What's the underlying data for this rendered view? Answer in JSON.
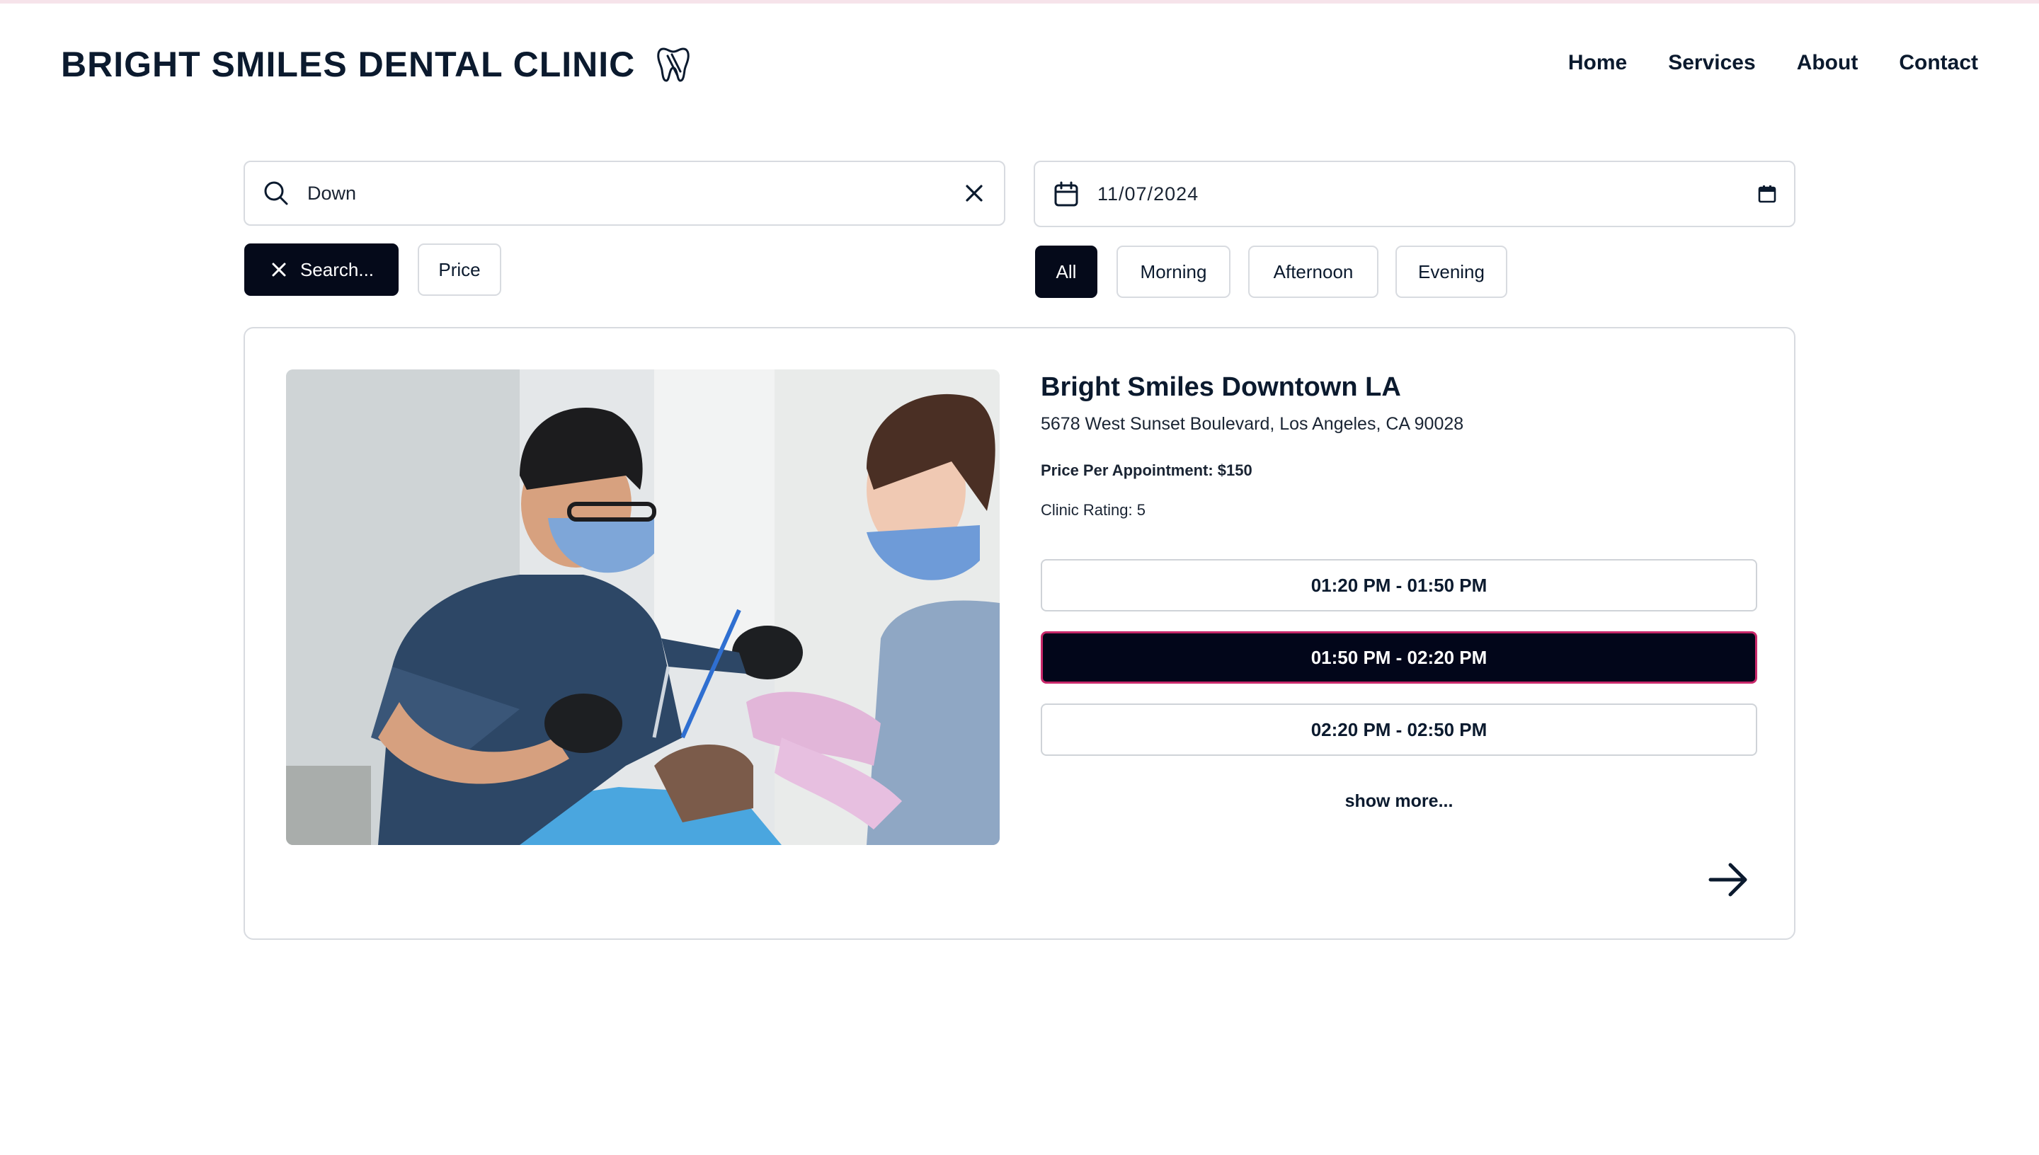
{
  "brand": {
    "title": "BRIGHT SMILES DENTAL CLINIC",
    "icon": "tooth-icon"
  },
  "nav": {
    "home": "Home",
    "services": "Services",
    "about": "About",
    "contact": "Contact"
  },
  "search": {
    "value": "Down",
    "icon": "search-icon",
    "clear_icon": "close-icon"
  },
  "date": {
    "value": "11/07/2024",
    "icon": "calendar-icon",
    "picker_icon": "calendar-picker-icon"
  },
  "filters": {
    "search_chip": "Search...",
    "price_chip": "Price",
    "time_all": "All",
    "time_morning": "Morning",
    "time_afternoon": "Afternoon",
    "time_evening": "Evening",
    "selected_time": "All"
  },
  "clinic": {
    "name": "Bright Smiles Downtown LA",
    "address": "5678 West Sunset Boulevard, Los Angeles, CA 90028",
    "price": "Price Per Appointment: $150",
    "rating": "Clinic Rating: 5",
    "photo": "dentist-treating-patient-photo"
  },
  "slots": [
    {
      "label": "01:20 PM - 01:50 PM",
      "selected": false
    },
    {
      "label": "01:50 PM - 02:20 PM",
      "selected": true
    },
    {
      "label": "02:20 PM - 02:50 PM",
      "selected": false
    }
  ],
  "show_more": "show more...",
  "colors": {
    "primary": "#050a1a",
    "accent_border": "#c8286a",
    "text": "#0b1a2e",
    "border": "#d8dbe0"
  }
}
